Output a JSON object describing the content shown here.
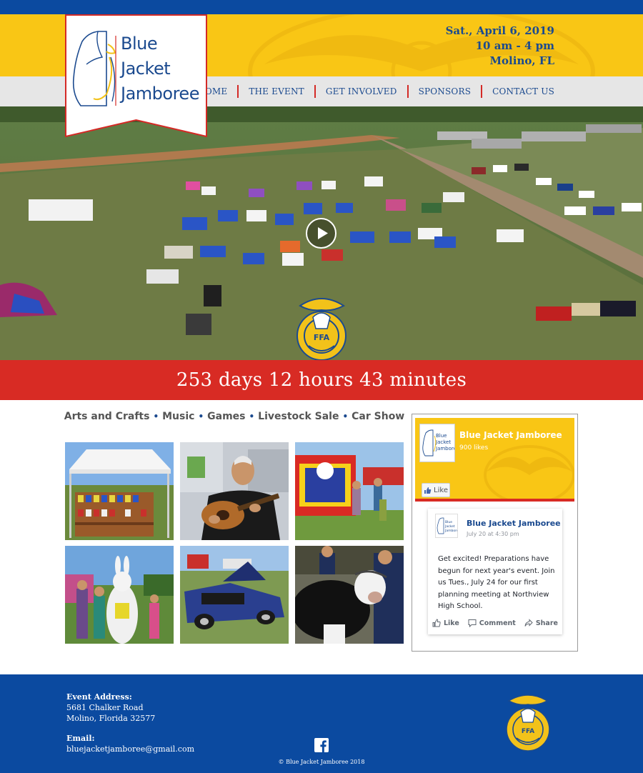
{
  "event": {
    "date": "Sat., April 6, 2019",
    "time": "10 am - 4 pm",
    "location": "Molino, FL"
  },
  "logo": {
    "line1": "Blue",
    "line2": "Jacket",
    "line3": "Jamboree"
  },
  "nav": {
    "items": [
      "HOME",
      "THE EVENT",
      "GET INVOLVED",
      "SPONSORS",
      "CONTACT US"
    ]
  },
  "hero": {
    "emblem_text": "AGRICULTURAL EDUCATION",
    "emblem_center": "FFA"
  },
  "countdown": {
    "text": "253 days 12 hours 43 minutes"
  },
  "activities": [
    "Arts and Crafts",
    "Music",
    "Games",
    "Livestock Sale",
    "Car Show"
  ],
  "facebook": {
    "page_name": "Blue Jacket Jamboree",
    "likes": "900 likes",
    "like_button": "Like",
    "post": {
      "author": "Blue Jacket Jamboree",
      "date": "July 20 at 4:30 pm",
      "text": "Get excited! Preparations have begun for next year's event. Join us Tues., July 24 for our first planning meeting at Northview High School."
    },
    "actions": {
      "like": "Like",
      "comment": "Comment",
      "share": "Share"
    }
  },
  "footer": {
    "address_label": "Event Address:",
    "address_line1": "5681 Chalker Road",
    "address_line2": "Molino, Florida 32577",
    "email_label": "Email:",
    "email": "bluejacketjamboree@gmail.com",
    "copyright": "© Blue Jacket Jamboree 2018"
  },
  "colors": {
    "blue": "#0b4aa0",
    "yellow": "#f9c615",
    "red": "#d82b24",
    "nav_grey": "#e6e6e6",
    "text_blue": "#1b4a8f"
  }
}
